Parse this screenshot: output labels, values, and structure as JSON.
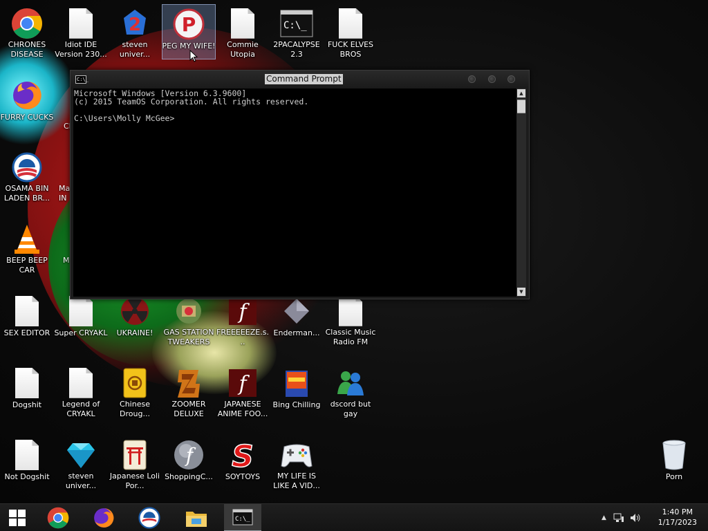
{
  "desktop_icons": [
    {
      "label": "CHRONES DISEASE",
      "icon": "chrome-icon"
    },
    {
      "label": "Idiot IDE Version 230...",
      "icon": "document-icon"
    },
    {
      "label": "steven univer...",
      "icon": "game-icon"
    },
    {
      "label": "PEG MY WIFE!",
      "icon": "p-logo-icon"
    },
    {
      "label": "Commie Utopia",
      "icon": "document-icon"
    },
    {
      "label": "2PACALYPSE 2.3",
      "icon": "console-icon"
    },
    {
      "label": "FUCK ELVES BROS",
      "icon": "document-icon"
    },
    {
      "label": "FURRY CUCKS",
      "icon": "firefox-icon"
    },
    {
      "label": "OSAMA BIN LADEN BR...",
      "icon": "obama-logo-icon"
    },
    {
      "label": "BEEP BEEP CAR",
      "icon": "vlc-cone-icon"
    },
    {
      "label": "SEX EDITOR",
      "icon": "document-icon"
    },
    {
      "label": "Super CRYAKL",
      "icon": "document-icon"
    },
    {
      "label": "UKRAINE!",
      "icon": "radiation-icon"
    },
    {
      "label": "GAS STATION TWEAKERS",
      "icon": "gas-station-icon"
    },
    {
      "label": "FREEEEEZE.s...",
      "icon": "flash-icon"
    },
    {
      "label": "Enderman...",
      "icon": "diamond-gray-icon"
    },
    {
      "label": "Classic Music Radio FM",
      "icon": "document-icon"
    },
    {
      "label": "Dogshit",
      "icon": "document-icon"
    },
    {
      "label": "Legend of CRYAKL",
      "icon": "document-icon"
    },
    {
      "label": "Chinese Droug...",
      "icon": "mahjong-tile-icon"
    },
    {
      "label": "ZOOMER DELUXE",
      "icon": "zoomer-icon"
    },
    {
      "label": "JAPANESE ANIME FOO...",
      "icon": "flash-icon"
    },
    {
      "label": "Bing Chilling",
      "icon": "box-icon"
    },
    {
      "label": "dscord but gay",
      "icon": "messenger-icon"
    },
    {
      "label": "Not Dogshit",
      "icon": "document-icon"
    },
    {
      "label": "steven univer...",
      "icon": "gem-icon"
    },
    {
      "label": "Japanese Loli Por...",
      "icon": "torii-tile-icon"
    },
    {
      "label": "ShoppingC...",
      "icon": "flash-sphere-icon"
    },
    {
      "label": "SOYTOYS",
      "icon": "red-s-icon"
    },
    {
      "label": "MY LIFE IS LIKE A VID...",
      "icon": "gamepad-icon"
    },
    {
      "label": "Porn",
      "icon": "recycle-bin-icon"
    }
  ],
  "partial_labels": [
    "Cl",
    "Ma\nIN",
    "M"
  ],
  "cmd_window": {
    "title": "Command Prompt",
    "icon_text": "C:\\_",
    "lines": [
      "Microsoft Windows [Version 6.3.9600]",
      "(c) 2015 TeamOS Corporation. All rights reserved.",
      "",
      "C:\\Users\\Molly McGee>"
    ]
  },
  "taskbar": {
    "items": [
      "start-button",
      "chrome-icon",
      "firefox-icon",
      "obama-logo-icon",
      "file-explorer-icon",
      "command-prompt-icon"
    ],
    "active": "command-prompt-icon",
    "tray_icons": [
      "chevron-up-icon",
      "network-icon",
      "volume-icon"
    ],
    "time": "1:40 PM",
    "date": "1/17/2023"
  },
  "colors": {
    "console_bg": "#000000",
    "console_text": "#cfcfcf",
    "taskbar": "#1a1a1a",
    "selection": "#8aa0d2"
  }
}
